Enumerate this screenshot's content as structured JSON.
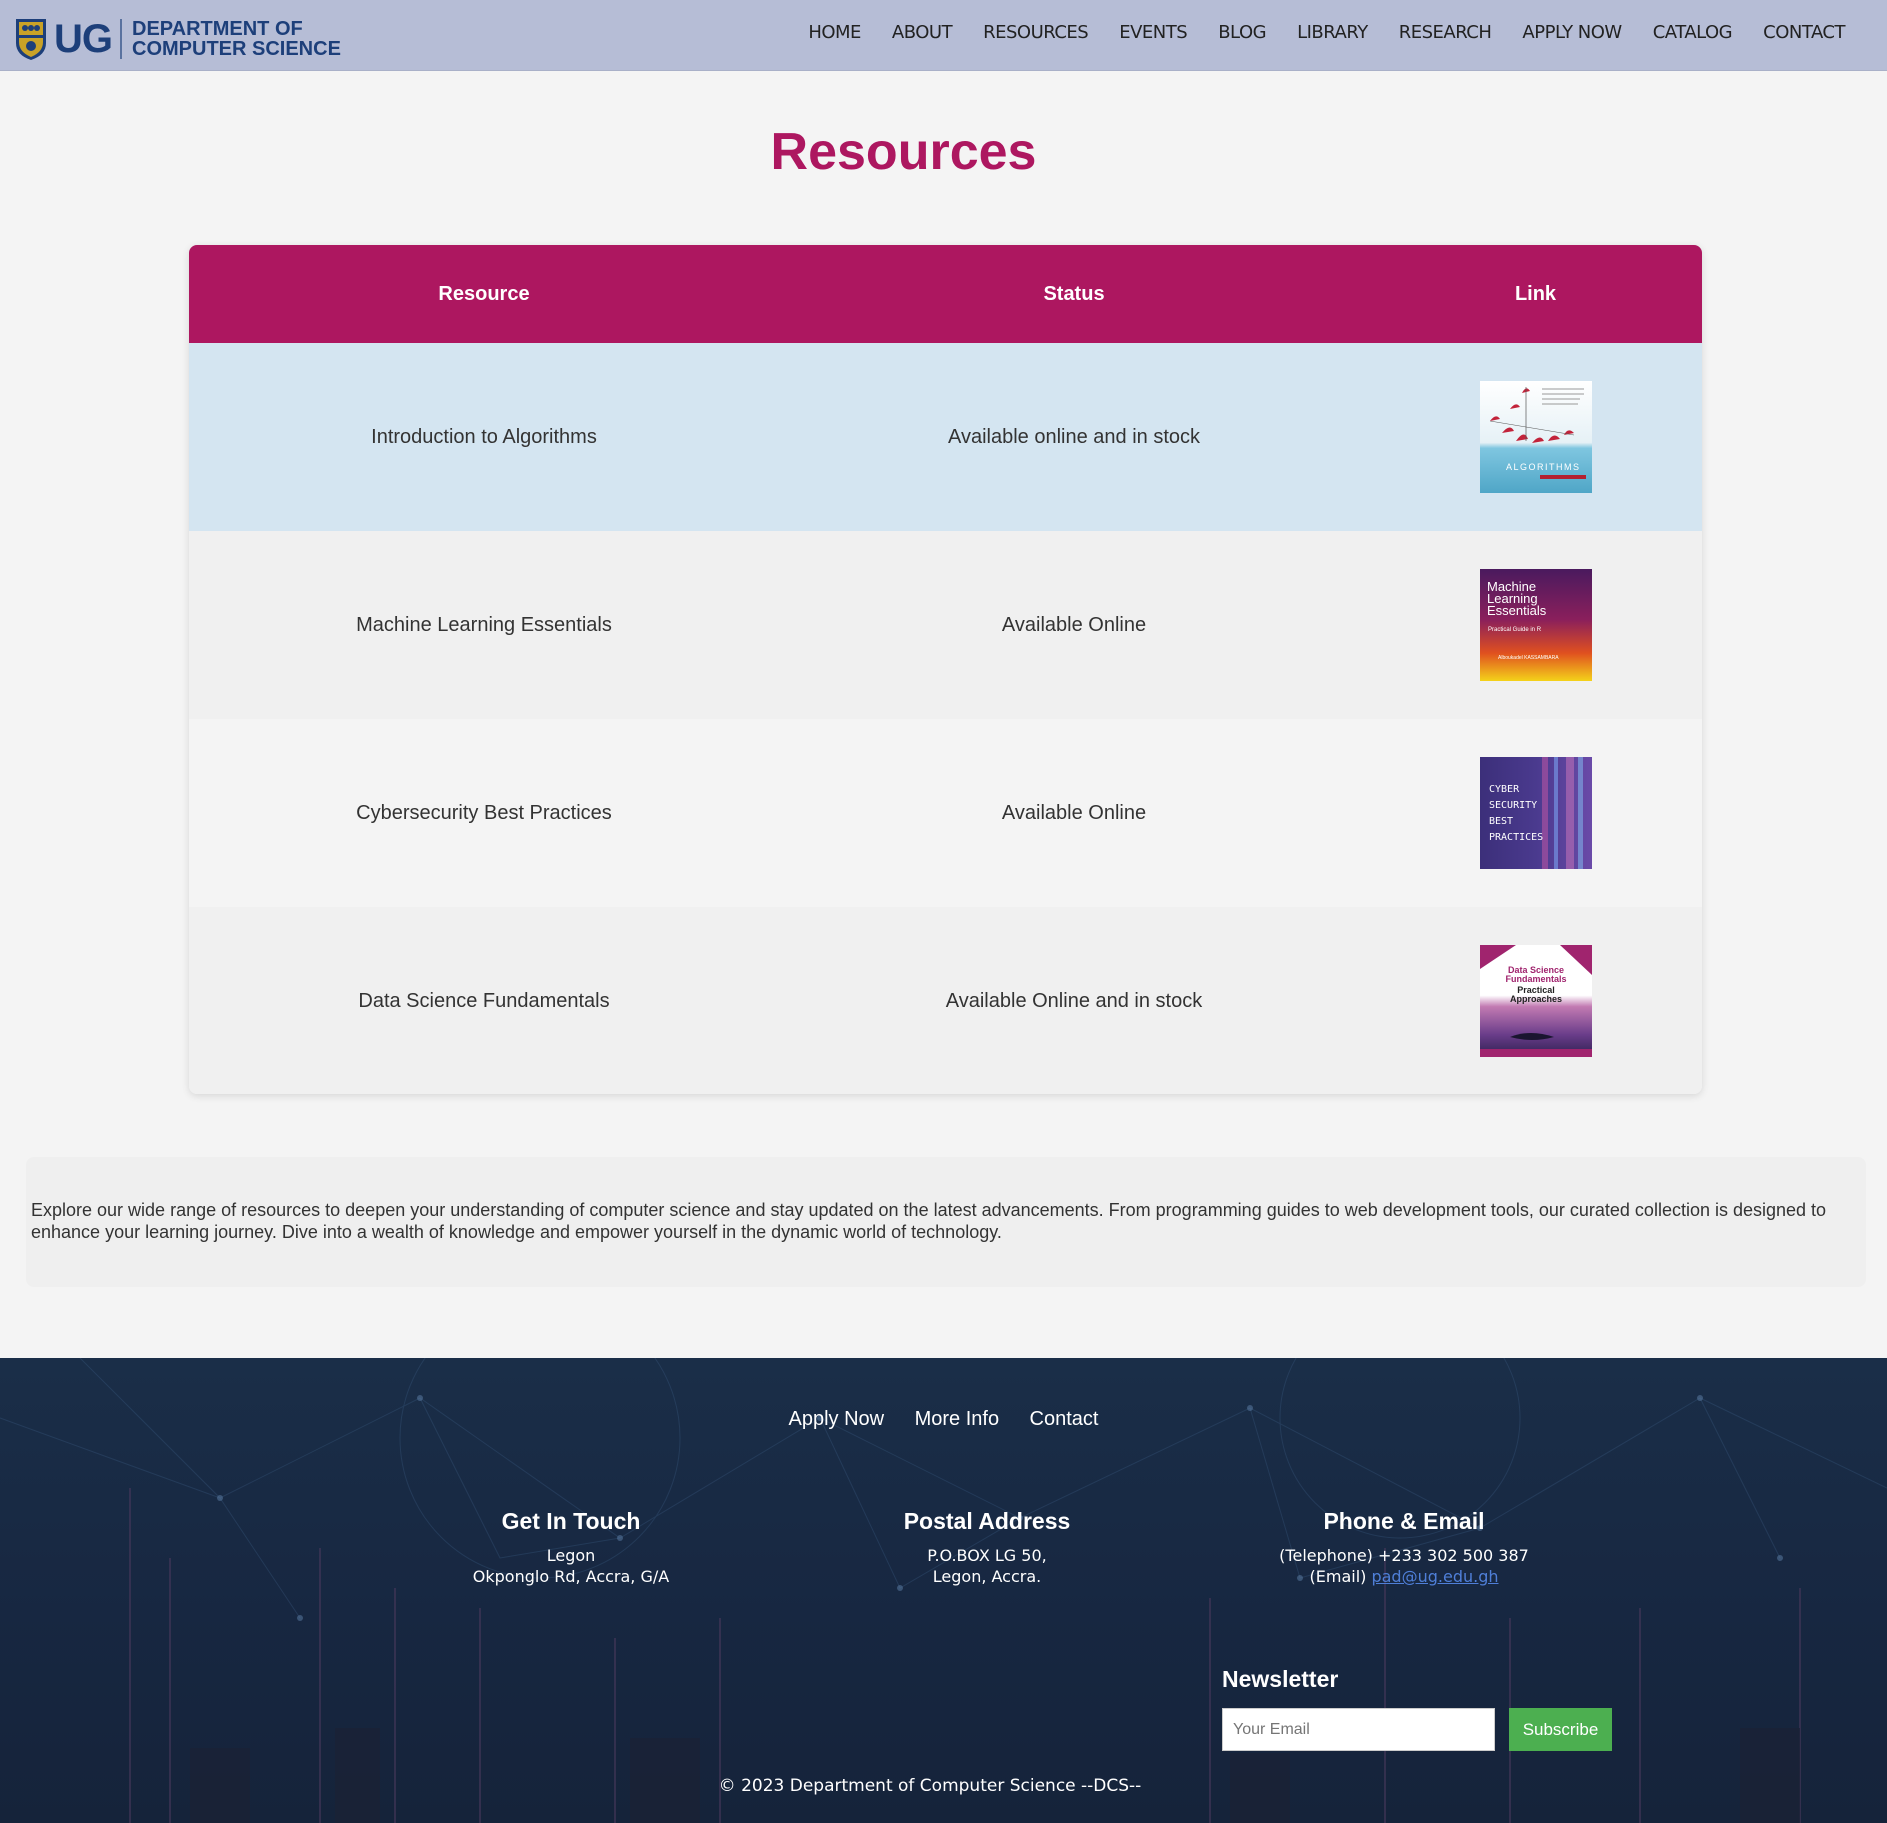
{
  "header": {
    "logo_letters": "UG",
    "logo_line1": "DEPARTMENT OF",
    "logo_line2": "COMPUTER SCIENCE",
    "nav": [
      "HOME",
      "ABOUT",
      "RESOURCES",
      "EVENTS",
      "BLOG",
      "LIBRARY",
      "RESEARCH",
      "APPLY NOW",
      "CATALOG",
      "CONTACT"
    ]
  },
  "page_title": "Resources",
  "table": {
    "headers": [
      "Resource",
      "Status",
      "Link"
    ],
    "rows": [
      {
        "resource": "Introduction to Algorithms",
        "status": "Available online and in stock",
        "cover": "ALGORITHMS"
      },
      {
        "resource": "Machine Learning Essentials",
        "status": "Available Online",
        "cover": "Machine Learning Essentials"
      },
      {
        "resource": "Cybersecurity Best Practices",
        "status": "Available Online",
        "cover": "CYBER SECURITY BEST PRACTICES"
      },
      {
        "resource": "Data Science Fundamentals",
        "status": "Available Online and in stock",
        "cover": "Data Science Fundamentals Practical Approaches"
      }
    ]
  },
  "description": "Explore our wide range of resources to deepen your understanding of computer science and stay updated on the latest advancements. From programming guides to web development tools, our curated collection is designed to enhance your learning journey. Dive into a wealth of knowledge and empower yourself in the dynamic world of technology.",
  "footer": {
    "links": [
      "Apply Now",
      "More Info",
      "Contact"
    ],
    "get_in_touch": {
      "title": "Get In Touch",
      "line1": "Legon",
      "line2": "Okponglo Rd, Accra, G/A"
    },
    "postal": {
      "title": "Postal Address",
      "line1": "P.O.BOX LG 50,",
      "line2": "Legon, Accra."
    },
    "phone_email": {
      "title": "Phone & Email",
      "phone": "(Telephone) +233 302 500 387",
      "email_label": "(Email) ",
      "email": "pad@ug.edu.gh"
    },
    "newsletter": {
      "title": "Newsletter",
      "placeholder": "Your Email",
      "button": "Subscribe"
    },
    "copyright": "© 2023 Department of Computer Science --DCS--"
  },
  "colors": {
    "accent": "#ad1760",
    "header_bg": "#b6bdd6",
    "brand_blue": "#1d3f7a",
    "subscribe": "#4caf50"
  }
}
